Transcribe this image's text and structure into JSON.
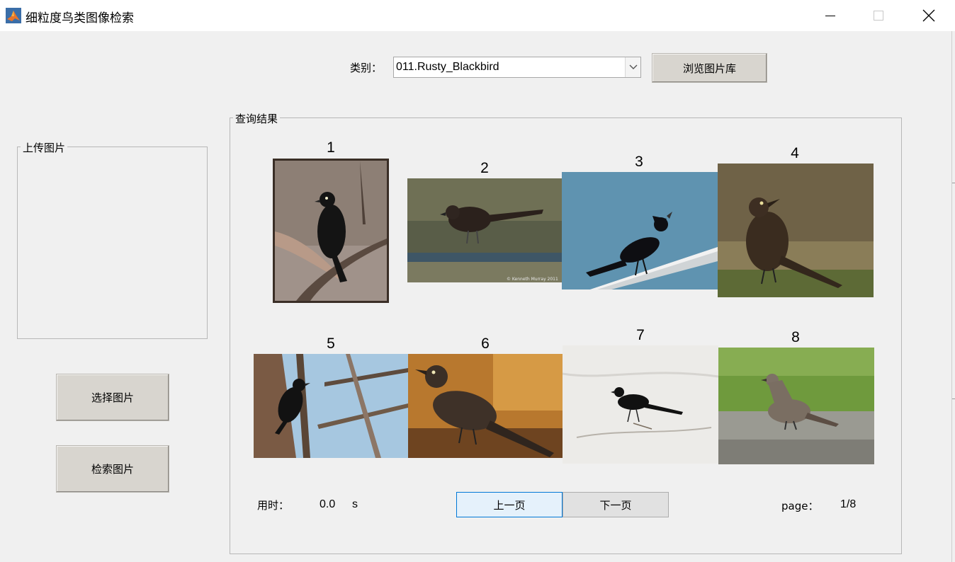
{
  "window": {
    "title": "细粒度鸟类图像检索"
  },
  "toolbar": {
    "category_label": "类别：",
    "category_value": "011.Rusty_Blackbird",
    "browse_label": "浏览图片库"
  },
  "upload_panel": {
    "title": "上传图片",
    "select_label": "选择图片",
    "search_label": "检索图片"
  },
  "results_panel": {
    "title": "查询结果",
    "items": [
      {
        "rank": "1",
        "subject": "blackbird-perched-on-branch"
      },
      {
        "rank": "2",
        "subject": "brown-bird-on-mudflat"
      },
      {
        "rank": "3",
        "subject": "black-bird-on-rail-blue-sky"
      },
      {
        "rank": "4",
        "subject": "brown-bird-in-grass"
      },
      {
        "rank": "5",
        "subject": "blackbird-in-bare-tree"
      },
      {
        "rank": "6",
        "subject": "rusty-bird-in-leaves"
      },
      {
        "rank": "7",
        "subject": "black-bird-on-snow"
      },
      {
        "rank": "8",
        "subject": "grey-bird-on-gravel"
      }
    ],
    "photo_credit": "© Kenneth Murray 2011",
    "time_label": "用时：",
    "time_value": "0.0",
    "time_unit": "s",
    "prev_label": "上一页",
    "next_label": "下一页",
    "page_label": "page：",
    "page_value": "1/8"
  },
  "colors": {
    "window_bg": "#f0f0f0",
    "button_face": "#d8d5cf",
    "prev_button_bg": "#e5f1fb",
    "prev_button_border": "#0078d7"
  },
  "icons": {
    "app": "matlab-logo-icon",
    "minimize": "minimize-icon",
    "maximize": "maximize-icon",
    "close": "close-icon",
    "dropdown": "chevron-down-icon"
  }
}
